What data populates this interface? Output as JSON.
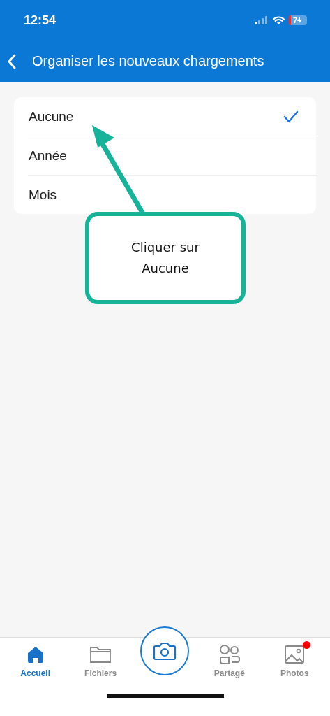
{
  "status_bar": {
    "time": "12:54",
    "battery": "7"
  },
  "nav": {
    "title": "Organiser les nouveaux chargements"
  },
  "options": [
    {
      "label": "Aucune",
      "selected": true
    },
    {
      "label": "Année",
      "selected": false
    },
    {
      "label": "Mois",
      "selected": false
    }
  ],
  "callout": {
    "text": "Cliquer sur Aucune"
  },
  "tab_bar": [
    {
      "kind": "home",
      "label": "Accueil",
      "selected": true
    },
    {
      "kind": "files",
      "label": "Fichiers",
      "selected": false
    },
    {
      "kind": "camera",
      "selected": false
    },
    {
      "kind": "shared",
      "label": "Partagé",
      "selected": false
    },
    {
      "kind": "photos",
      "label": "Photos",
      "selected": false,
      "badge": true
    }
  ]
}
